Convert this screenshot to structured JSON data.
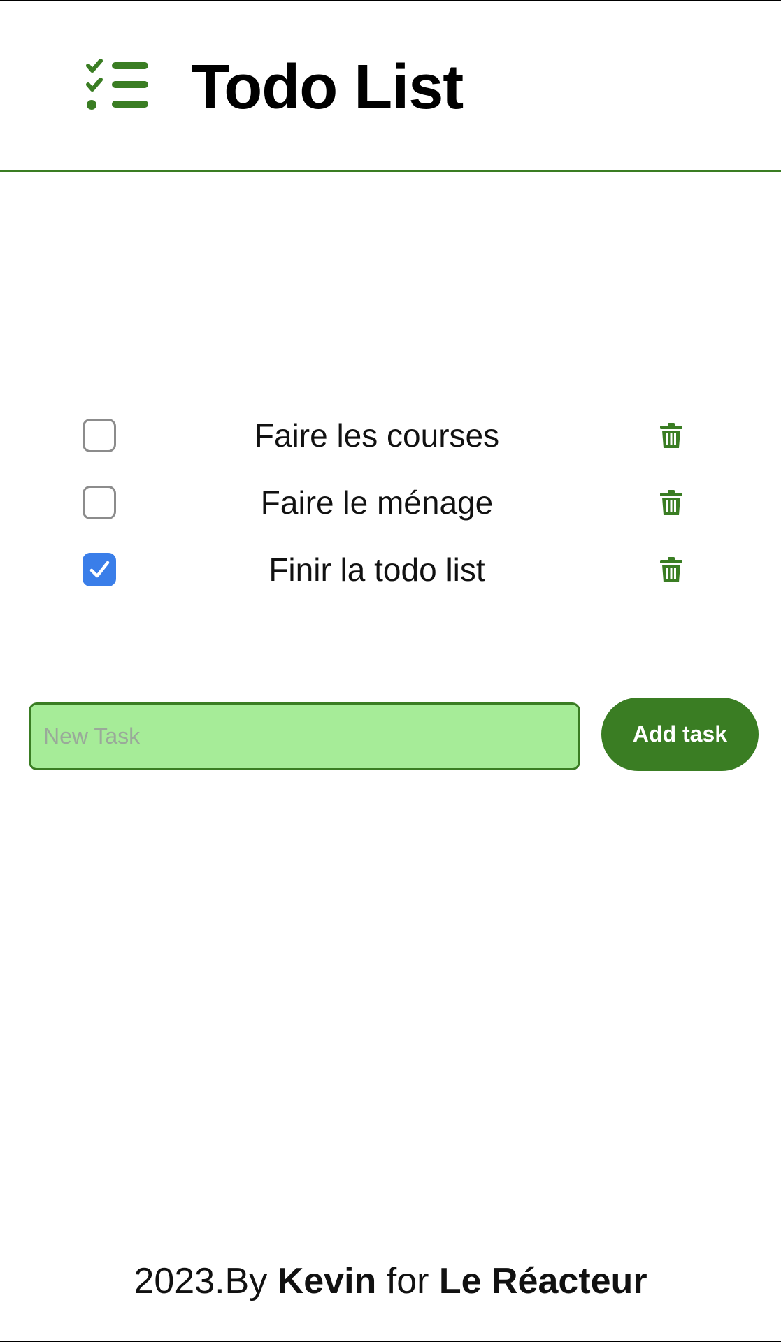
{
  "header": {
    "title": "Todo List",
    "logo_icon": "checklist-icon"
  },
  "tasks": [
    {
      "label": "Faire les courses",
      "checked": false
    },
    {
      "label": "Faire le ménage",
      "checked": false
    },
    {
      "label": "Finir la todo list",
      "checked": true
    }
  ],
  "new_task": {
    "placeholder": "New Task",
    "value": "",
    "add_label": "Add task"
  },
  "footer": {
    "prefix": "2023.By ",
    "author": "Kevin",
    "middle": " for ",
    "org": "Le Réacteur"
  },
  "colors": {
    "accent_green": "#3a7d23",
    "input_background": "#a6ec98",
    "checkbox_checked": "#3a7ee9",
    "checkbox_border": "#8c8c8c"
  }
}
